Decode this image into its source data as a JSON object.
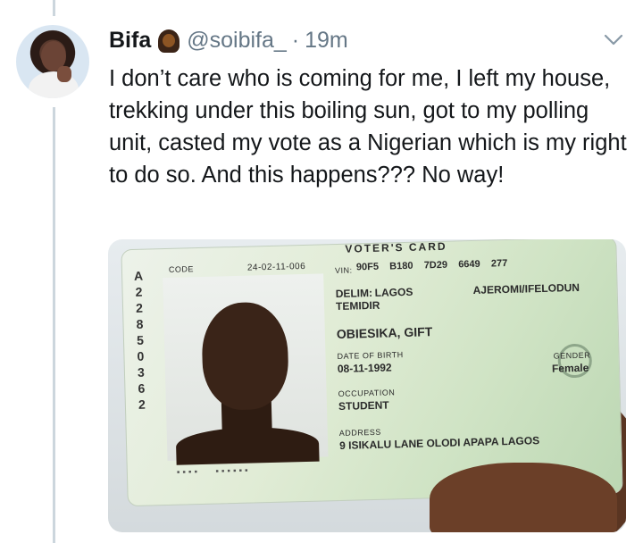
{
  "tweet": {
    "display_name": "Bifa",
    "handle": "@soibifa_",
    "separator": "·",
    "time": "19m",
    "text": "I don’t care who is coming for me, I left my house, trekking under this boiling sun, got to my polling unit, casted my vote as a Nigerian which is my right to do so. And this happens??? No way!"
  },
  "icons": {
    "avatar": "avatar-photo",
    "emoji": "woman-emoji",
    "menu": "chevron-down-icon"
  },
  "card": {
    "heading": "VOTER'S CARD",
    "code_label": "CODE",
    "code_value": "24-02-11-006",
    "vin_label": "VIN:",
    "vin_value": "90F5    B180    7D29    6649    277",
    "delim_label": "DELIM:",
    "delim_value": "LAGOS",
    "lga": "AJEROMI/IFELODUN",
    "delim_extra": "TEMIDIR",
    "name": "OBIESIKA, GIFT",
    "dob_label": "DATE OF BIRTH",
    "dob_value": "08-11-1992",
    "gender_label": "GENDER",
    "gender_value": "Female",
    "occupation_label": "OCCUPATION",
    "occupation_value": "STUDENT",
    "address_label": "ADDRESS",
    "address_value": "9 ISIKALU LANE OLODI APAPA LAGOS",
    "side_code": [
      "A",
      "2",
      "2",
      "8",
      "5",
      "0",
      "3",
      "6",
      "2"
    ]
  },
  "colors": {
    "text_primary": "#14171a",
    "text_secondary": "#657786",
    "thread_line": "#ccd6dd"
  }
}
